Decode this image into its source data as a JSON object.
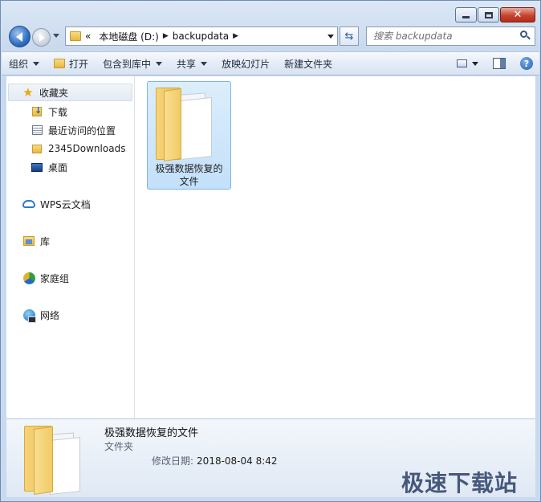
{
  "window": {
    "caption": {
      "min": "minimize",
      "max": "maximize",
      "close": "✕"
    }
  },
  "address": {
    "overflow": "«",
    "crumbs": [
      "本地磁盘 (D:)",
      "backupdata"
    ],
    "search_placeholder": "搜索 backupdata"
  },
  "toolbar": {
    "organize": "组织",
    "open": "打开",
    "include_library": "包含到库中",
    "share": "共享",
    "slideshow": "放映幻灯片",
    "new_folder": "新建文件夹",
    "help": "?"
  },
  "sidebar": {
    "favorites": "收藏夹",
    "downloads": "下载",
    "recent": "最近访问的位置",
    "downloads2345": "2345Downloads",
    "desktop": "桌面",
    "wps": "WPS云文档",
    "libraries": "库",
    "homegroup": "家庭组",
    "network": "网络"
  },
  "files": [
    {
      "name_line1": "极强数据恢复的",
      "name_line2": "文件"
    }
  ],
  "details": {
    "name": "极强数据恢复的文件",
    "type": "文件夹",
    "modified_label": "修改日期:",
    "modified_value": "2018-08-04 8:42"
  },
  "watermark": "极速下载站"
}
